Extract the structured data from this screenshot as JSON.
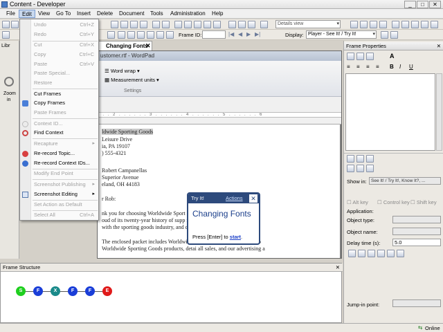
{
  "window": {
    "title": "Content - Developer"
  },
  "menubar": {
    "items": [
      "File",
      "Edit",
      "View",
      "Go To",
      "Insert",
      "Delete",
      "Document",
      "Tools",
      "Administration",
      "Help"
    ]
  },
  "toolbar": {
    "details_view": "Details view",
    "frame_id_label": "Frame ID:",
    "display_label": "Display:",
    "display_value": "Player - See It! / Try It!"
  },
  "leftpanel": {
    "tab": "Libr",
    "zoom_label": "Zoom",
    "zoom_in": "in"
  },
  "edit_menu": {
    "items": [
      {
        "label": "Undo",
        "shortcut": "Ctrl+Z",
        "disabled": true
      },
      {
        "label": "Redo",
        "shortcut": "Ctrl+Y",
        "disabled": true
      },
      {
        "label": "Cut",
        "shortcut": "Ctrl+X",
        "disabled": true
      },
      {
        "label": "Copy",
        "shortcut": "Ctrl+C",
        "disabled": true
      },
      {
        "label": "Paste",
        "shortcut": "Ctrl+V",
        "disabled": true
      },
      {
        "label": "Paste Special...",
        "shortcut": "",
        "disabled": true
      },
      {
        "label": "Restore",
        "shortcut": "",
        "disabled": true
      },
      {
        "label": "Cut Frames",
        "shortcut": "",
        "disabled": false
      },
      {
        "label": "Copy Frames",
        "shortcut": "",
        "disabled": false
      },
      {
        "label": "Paste Frames",
        "shortcut": "",
        "disabled": true
      },
      {
        "label": "Context ID...",
        "shortcut": "",
        "disabled": true
      },
      {
        "label": "Find Context",
        "shortcut": "",
        "disabled": false
      },
      {
        "label": "Recapture",
        "shortcut": "",
        "disabled": true
      },
      {
        "label": "Re-record Topic...",
        "shortcut": "",
        "disabled": false
      },
      {
        "label": "Re-record Context IDs...",
        "shortcut": "",
        "disabled": false
      },
      {
        "label": "Modify End Point",
        "shortcut": "",
        "disabled": true
      },
      {
        "label": "Screenshot Publishing",
        "shortcut": "",
        "disabled": true
      },
      {
        "label": "Screenshot Editing",
        "shortcut": "",
        "disabled": false
      },
      {
        "label": "Set Action as Default",
        "shortcut": "",
        "disabled": true
      },
      {
        "label": "Select All",
        "shortcut": "Ctrl+A",
        "disabled": true
      }
    ]
  },
  "document": {
    "tab_label": "Changing Fonts",
    "wordpad_title": "ustomer.rtf - WordPad",
    "ribbon": {
      "word_wrap": "Word wrap",
      "measurement_units": "Measurement units",
      "settings": "Settings"
    },
    "lines": [
      "ldwide Sporting Goods",
      " Leisure Drive",
      "ia, PA 19107",
      ") 555-4321",
      "Robert Campanellas",
      " Superior Avenue",
      "eland, OH 44183",
      "r Rob:",
      "nk you for choosing Worldwide Sport          er of recreational equipment. W",
      "oud of its twenty-year history of supp       nt customer service. We have",
      "with the sporting goods industry, and cur       the United States, Canada, an",
      "The enclosed packet includes Worldwide        e benefits of stocking your sto",
      "Worldwide Sporting Goods products, detai      all sales, and our advertising a"
    ]
  },
  "tryit": {
    "tag": "Try It!",
    "actions": "Actions",
    "heading": "Changing Fonts",
    "prompt": "Press [Enter] to ",
    "link": "start",
    "period": "."
  },
  "frame_properties": {
    "title": "Frame Properties",
    "show_in_label": "Show in:",
    "show_in_value": "See It! / Try It!, Know It?, ...",
    "alt_key": "Alt key",
    "control_key": "Control key",
    "shift_key": "Shift key",
    "application": "Application:",
    "object_type": "Object type:",
    "object_name": "Object name:",
    "delay_time_label": "Delay time (s):",
    "delay_time_value": "5.0",
    "jump_in_point": "Jump-in point:"
  },
  "frame_structure": {
    "title": "Frame Structure",
    "nodes": [
      {
        "label": "S",
        "color": "#1fcf1f"
      },
      {
        "label": "F",
        "color": "#1a3ed8"
      },
      {
        "label": "X",
        "color": "#1a8a8a"
      },
      {
        "label": "F",
        "color": "#1a3ed8"
      },
      {
        "label": "F",
        "color": "#1a3ed8"
      },
      {
        "label": "E",
        "color": "#e01a1a"
      }
    ]
  },
  "status": {
    "online": "Online"
  }
}
